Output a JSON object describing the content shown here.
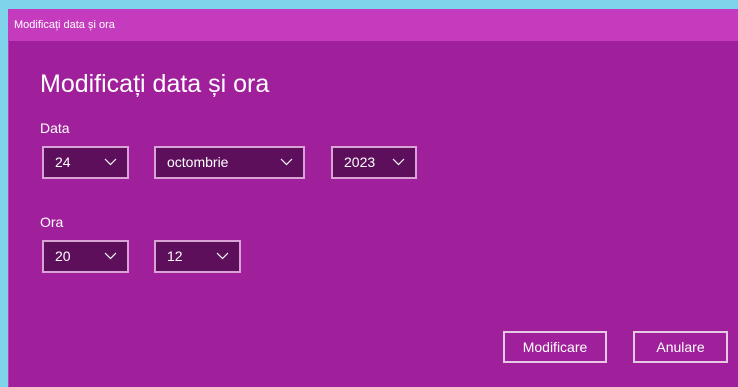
{
  "window": {
    "title": "Modificați data și ora"
  },
  "main": {
    "heading": "Modificați data și ora",
    "date_label": "Data",
    "day": "24",
    "month": "octombrie",
    "year": "2023",
    "time_label": "Ora",
    "hour": "20",
    "minute": "12"
  },
  "buttons": {
    "confirm_label": "Modificare",
    "cancel_label": "Anulare"
  },
  "colors": {
    "background": "#a0209b",
    "titlebar": "#c43cbd",
    "select_fill": "#5d0f5b"
  },
  "icons": {
    "dropdown": "chevron-down-icon"
  }
}
